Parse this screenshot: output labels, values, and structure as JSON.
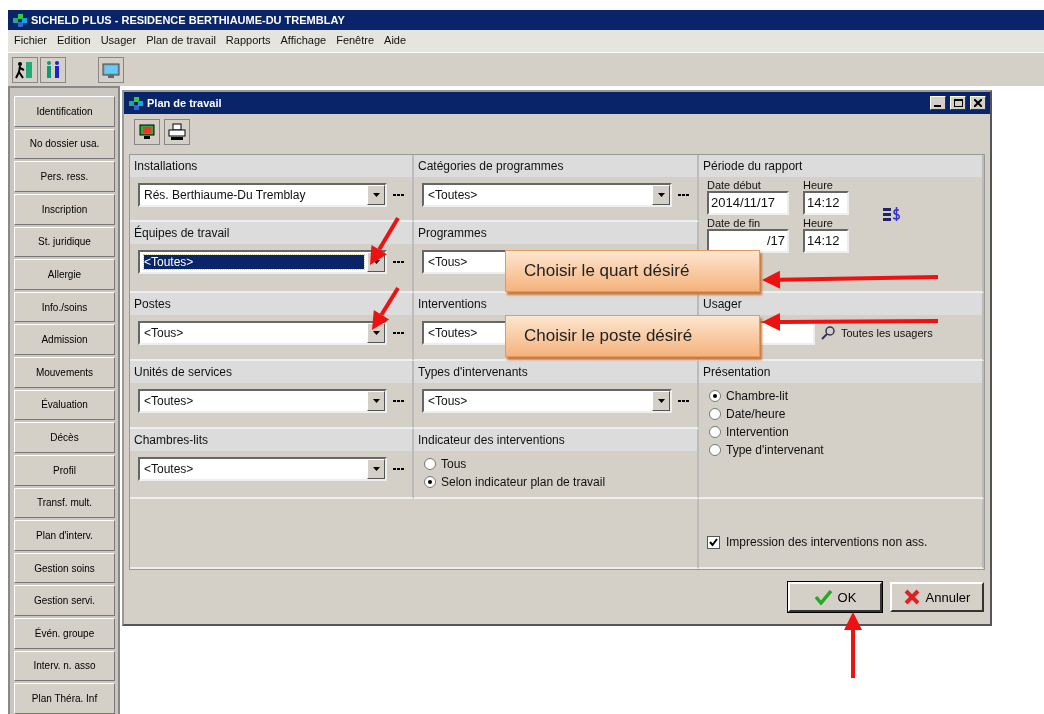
{
  "app": {
    "title": "SICHELD PLUS - RESIDENCE BERTHIAUME-DU TREMBLAY",
    "menu": [
      "Fichier",
      "Edition",
      "Usager",
      "Plan de travail",
      "Rapports",
      "Affichage",
      "Fenêtre",
      "Aide"
    ]
  },
  "sidebar": {
    "items": [
      {
        "label": "Identification"
      },
      {
        "label": "No dossier usa."
      },
      {
        "label": "Pers. ress."
      },
      {
        "label": "Inscription"
      },
      {
        "label": "St. juridique"
      },
      {
        "label": "Allergie"
      },
      {
        "label": "Info./soins"
      },
      {
        "label": "Admission"
      },
      {
        "label": "Mouvements"
      },
      {
        "label": "Évaluation"
      },
      {
        "label": "Décès"
      },
      {
        "label": "Profil"
      },
      {
        "label": "Transf. mult."
      },
      {
        "label": "Plan d'interv."
      },
      {
        "label": "Gestion soins"
      },
      {
        "label": "Gestion servi."
      },
      {
        "label": "Évén. groupe"
      },
      {
        "label": "Interv. n. asso"
      },
      {
        "label": "Plan Théra. Inf"
      }
    ]
  },
  "dialog": {
    "title": "Plan de travail",
    "left_column": [
      {
        "label": "Installations",
        "kind": "combo",
        "value": "Rés. Berthiaume-Du Tremblay",
        "focused": false
      },
      {
        "label": "Équipes de travail",
        "kind": "combo",
        "value": "<Toutes>",
        "focused": true
      },
      {
        "label": "Postes",
        "kind": "combo",
        "value": "<Tous>",
        "focused": false
      },
      {
        "label": "Unités de services",
        "kind": "combo",
        "value": "<Toutes>",
        "focused": false
      },
      {
        "label": "Chambres-lits",
        "kind": "combo",
        "value": "<Toutes>",
        "focused": false
      }
    ],
    "middle_column": [
      {
        "label": "Catégories de programmes",
        "kind": "combo",
        "value": "<Toutes>",
        "focused": false
      },
      {
        "label": "Programmes",
        "kind": "combo",
        "value": "<Tous>",
        "focused": false,
        "buttons_visible": false
      },
      {
        "label": "Interventions",
        "kind": "combo",
        "value": "<Toutes>",
        "focused": false,
        "buttons_visible": false
      },
      {
        "label": "Types d'intervenants",
        "kind": "combo",
        "value": "<Tous>",
        "focused": false
      },
      {
        "label": "Indicateur des interventions",
        "kind": "radios",
        "options": [
          {
            "label": "Tous",
            "selected": false
          },
          {
            "label": "Selon indicateur plan de travail",
            "selected": true
          }
        ]
      }
    ],
    "period": {
      "label": "Période du rapport",
      "start_date_label": "Date début",
      "start_date": "2014/11/17",
      "start_time_label": "Heure",
      "start_time": "14:12",
      "end_date_label": "Date de fin",
      "end_date": "/17",
      "end_time_label": "Heure",
      "end_time": "14:12"
    },
    "user": {
      "label": "Usager",
      "hint": "Toutes les usagers"
    },
    "presentation": {
      "label": "Présentation",
      "options": [
        {
          "label": "Chambre-lit",
          "selected": true
        },
        {
          "label": "Date/heure",
          "selected": false
        },
        {
          "label": "Intervention",
          "selected": false
        },
        {
          "label": "Type d'intervenant",
          "selected": false
        }
      ]
    },
    "print_option": {
      "label": "Impression des interventions non ass.",
      "checked": true
    },
    "buttons": [
      {
        "label": "OK",
        "kind": "ok"
      },
      {
        "label": "Annuler",
        "kind": "cancel"
      }
    ]
  },
  "callouts": [
    "Choisir le quart désiré",
    "Choisir le poste désiré"
  ]
}
